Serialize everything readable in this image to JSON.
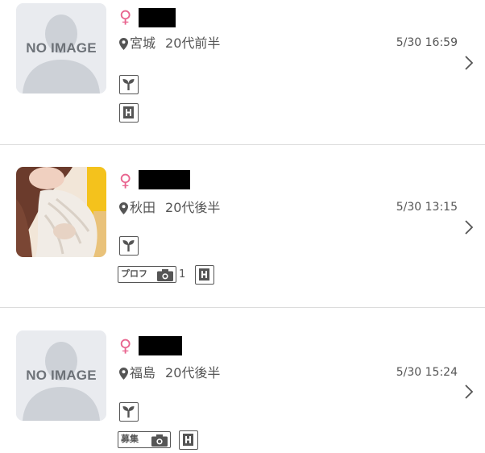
{
  "list": [
    {
      "avatar_text": "NO IMAGE",
      "gender_symbol": "♀",
      "location": "宮城",
      "age": "20代前半",
      "time": "5/30 16:59",
      "gender_color": "#e8638e"
    },
    {
      "avatar_text": "",
      "gender_symbol": "♀",
      "location": "秋田",
      "age": "20代後半",
      "time": "5/30 13:15",
      "tag_label": "プロフ",
      "photo_count": "1"
    },
    {
      "avatar_text": "NO IMAGE",
      "gender_symbol": "♀",
      "location": "福島",
      "age": "20代後半",
      "time": "5/30 15:24",
      "tag_label": "募集"
    }
  ],
  "icons": {
    "location": "map-pin-icon",
    "verified": "sprout-icon",
    "hotel": "h-building-icon",
    "photo": "camera-icon",
    "chevron": "chevron-right-icon"
  },
  "colors": {
    "female": "#e8638e",
    "divider": "#dcdcdc",
    "text": "#555555"
  }
}
